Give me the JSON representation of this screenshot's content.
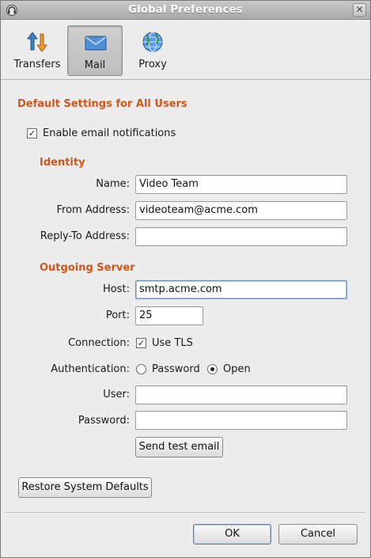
{
  "window": {
    "title": "Global Preferences"
  },
  "toolbar": {
    "items": [
      {
        "label": "Transfers",
        "icon": "transfer-arrows-icon"
      },
      {
        "label": "Mail",
        "icon": "envelope-icon",
        "selected": true
      },
      {
        "label": "Proxy",
        "icon": "globe-icon"
      }
    ]
  },
  "colors": {
    "section": "#d2561b",
    "selected_tab": "#c7c7c7"
  },
  "mail": {
    "section_title": "Default Settings for All Users",
    "enable_notifications": {
      "label": "Enable email notifications",
      "checked": true
    },
    "identity": {
      "title": "Identity",
      "name_label": "Name:",
      "name_value": "Video Team",
      "from_label": "From Address:",
      "from_value": "videoteam@acme.com",
      "replyto_label": "Reply-To Address:",
      "replyto_value": ""
    },
    "server": {
      "title": "Outgoing Server",
      "host_label": "Host:",
      "host_value": "smtp.acme.com",
      "port_label": "Port:",
      "port_value": "25",
      "connection_label": "Connection:",
      "tls_label": "Use TLS",
      "tls_checked": true,
      "auth_label": "Authentication:",
      "auth_options": [
        "Password",
        "Open"
      ],
      "auth_selected": "Open",
      "user_label": "User:",
      "user_value": "",
      "password_label": "Password:",
      "password_value": "",
      "test_button": "Send test email"
    },
    "restore_button": "Restore System Defaults"
  },
  "footer": {
    "ok": "OK",
    "cancel": "Cancel"
  }
}
